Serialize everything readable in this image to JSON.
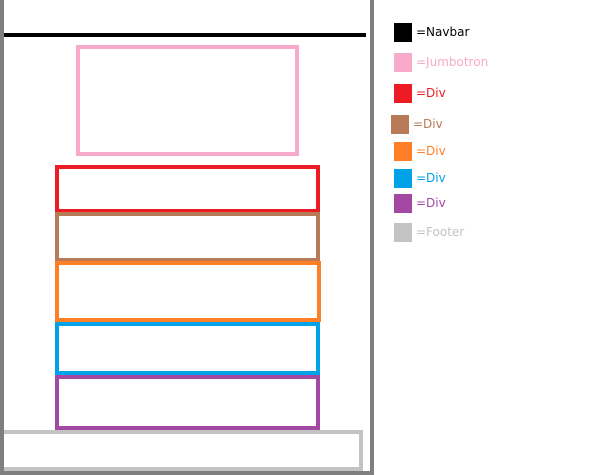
{
  "legend": [
    {
      "label": "=Navbar",
      "color": "#000000"
    },
    {
      "label": "=Jumbotron",
      "color": "#f7aac9"
    },
    {
      "label": "=Div",
      "color": "#ed1c24"
    },
    {
      "label": "=Div",
      "color": "#b97a57"
    },
    {
      "label": "=Div",
      "color": "#ff7f27"
    },
    {
      "label": "=Div",
      "color": "#00a2e8"
    },
    {
      "label": "=Div",
      "color": "#a349a4"
    },
    {
      "label": "=Footer",
      "color": "#c3c3c3"
    }
  ]
}
